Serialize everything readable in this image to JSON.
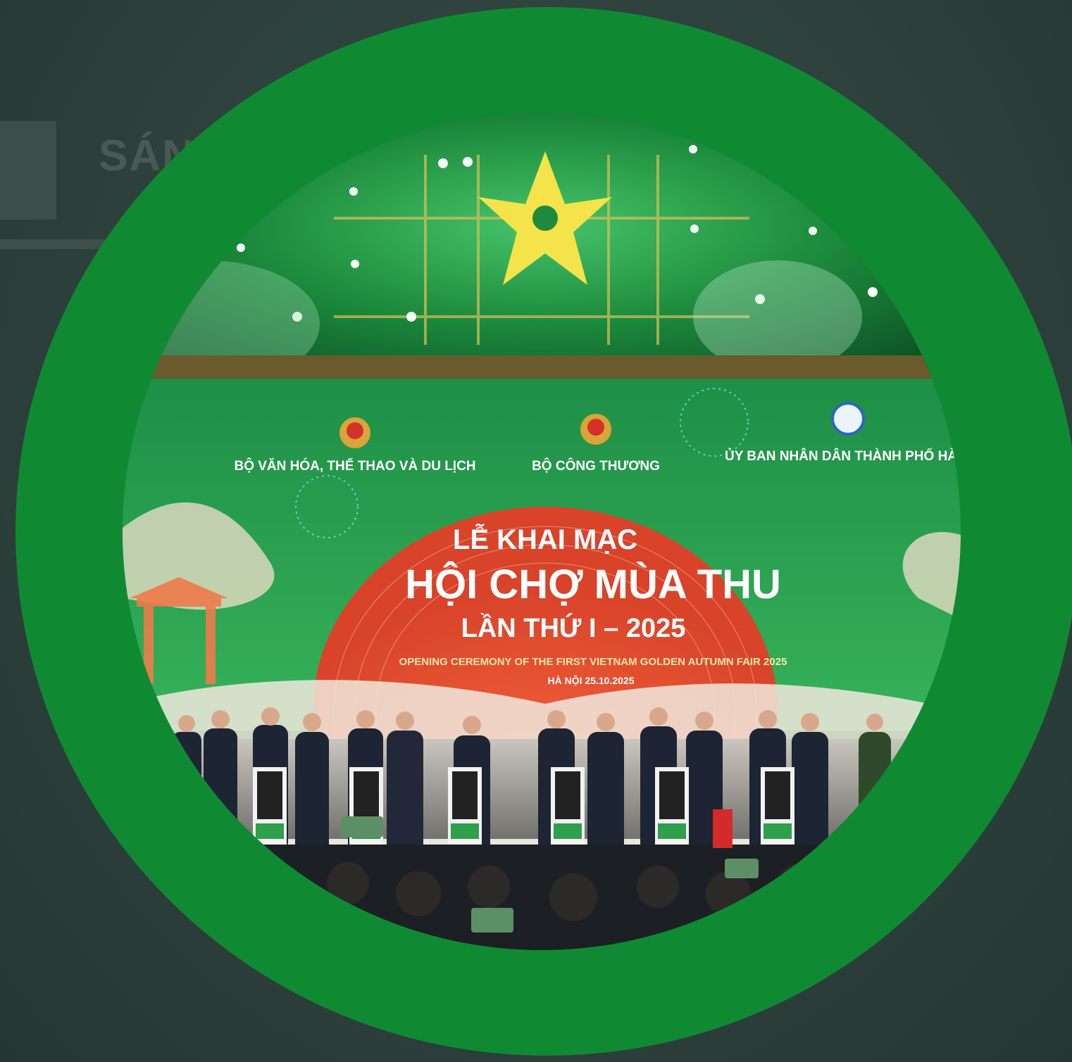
{
  "background": {
    "partial_text": "SÁN"
  },
  "screen": {
    "logos": [
      {
        "label": "BỘ VĂN HÓA, THỂ THAO VÀ DU LỊCH"
      },
      {
        "label": "BỘ CÔNG THƯƠNG"
      },
      {
        "label": "ỦY BAN NHÂN DÂN THÀNH PHỐ HÀ"
      }
    ],
    "line1": "LỄ KHAI MẠC",
    "line2": "HỘI CHỢ MÙA THU",
    "line3": "LẦN THỨ I – 2025",
    "english": "OPENING CEREMONY OF THE FIRST VIETNAM GOLDEN AUTUMN FAIR 2025",
    "place_date": "HÀ NỘI   25.10.2025"
  },
  "colors": {
    "ring": "#0f8a33",
    "backdrop": "#2c3f3b",
    "screen_green": "#1f9a46",
    "sun": "#ec5a34",
    "star": "#f4e34a"
  }
}
